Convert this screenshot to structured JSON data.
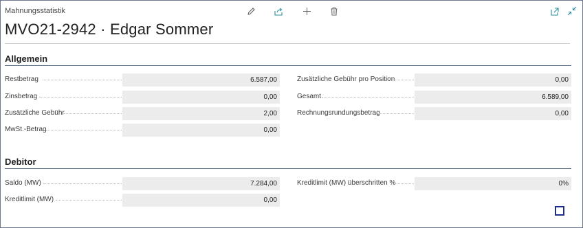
{
  "header": {
    "caption": "Mahnungsstatistik",
    "title": "MVO21-2942 · Edgar Sommer",
    "icons": [
      "edit-icon",
      "share-icon",
      "add-icon",
      "delete-icon",
      "open-new-window-icon",
      "collapse-icon"
    ]
  },
  "sections": {
    "allgemein": {
      "title": "Allgemein",
      "left": [
        {
          "label": "Restbetrag",
          "value": "6.587,00"
        },
        {
          "label": "Zinsbetrag",
          "value": "0,00"
        },
        {
          "label": "Zusätzliche Gebühr",
          "value": "2,00"
        },
        {
          "label": "MwSt.-Betrag",
          "value": "0,00"
        }
      ],
      "right": [
        {
          "label": "Zusätzliche Gebühr pro Position",
          "value": "0,00"
        },
        {
          "label": "Gesamt",
          "value": "6.589,00"
        },
        {
          "label": "Rechnungsrundungsbetrag",
          "value": "0,00"
        }
      ]
    },
    "debitor": {
      "title": "Debitor",
      "left": [
        {
          "label": "Saldo (MW)",
          "value": "7.284,00"
        },
        {
          "label": "Kreditlimit (MW)",
          "value": "0,00"
        }
      ],
      "right": [
        {
          "label": "Kreditlimit (MW) überschritten %",
          "value": "0%"
        }
      ]
    }
  },
  "colors": {
    "accent": "#2a8ca0",
    "field_bg": "#ececec",
    "section_line": "#5a6f87",
    "checkbox_border": "#1f2c8c"
  }
}
